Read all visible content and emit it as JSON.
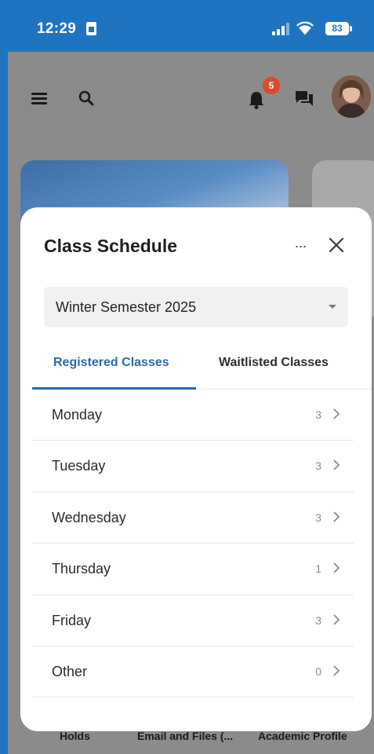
{
  "status_bar": {
    "time": "12:29",
    "battery": "83"
  },
  "app": {
    "notification_count": "5",
    "bottom_tabs": [
      "Holds",
      "Email and Files (...",
      "Academic Profile"
    ]
  },
  "modal": {
    "title": "Class Schedule",
    "more_label": "···",
    "semester": "Winter Semester 2025",
    "tabs": [
      {
        "label": "Registered Classes",
        "active": true
      },
      {
        "label": "Waitlisted Classes",
        "active": false
      }
    ],
    "days": [
      {
        "label": "Monday",
        "count": "3"
      },
      {
        "label": "Tuesday",
        "count": "3"
      },
      {
        "label": "Wednesday",
        "count": "3"
      },
      {
        "label": "Thursday",
        "count": "1"
      },
      {
        "label": "Friday",
        "count": "3"
      },
      {
        "label": "Other",
        "count": "0"
      }
    ]
  },
  "colors": {
    "status_bar": "#1f74c2",
    "accent": "#2b6aa7",
    "badge": "#d94a2e"
  }
}
